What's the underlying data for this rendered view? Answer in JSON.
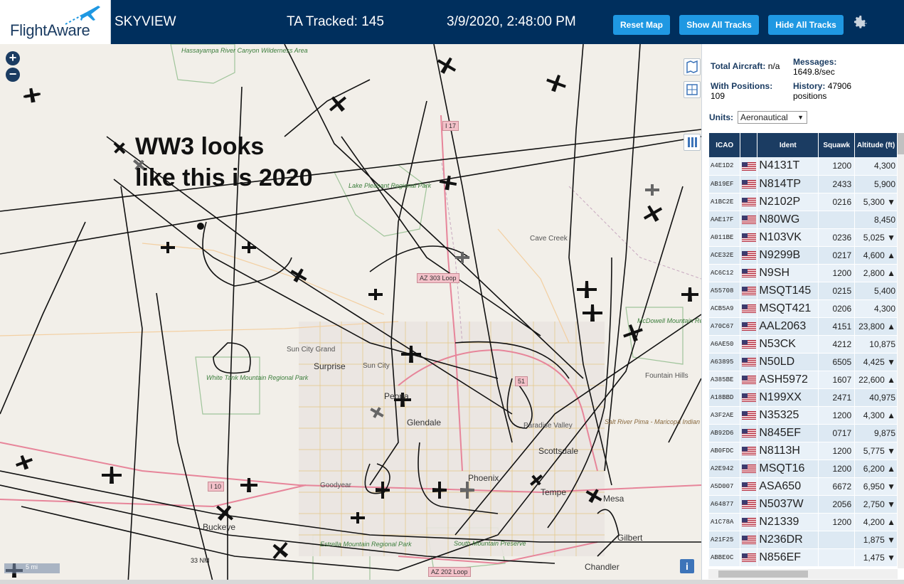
{
  "header": {
    "logo_text": "FlightAware",
    "app_title": "SKYVIEW",
    "ta_tracked": "TA Tracked: 145",
    "datetime": "3/9/2020, 2:48:00 PM",
    "buttons": {
      "reset": "Reset Map",
      "show_all": "Show All Tracks",
      "hide_all": "Hide All Tracks"
    },
    "settings_icon": "gear-icon"
  },
  "map": {
    "annotation": "WW3 looks\nlike this is 2020",
    "zoom_in": "+",
    "zoom_out": "−",
    "scale_label": "5 mi",
    "scale_nm": "33 NM",
    "info": "i",
    "labels": {
      "hassayampa": "Hassayampa River Canyon Wilderness Area",
      "lake_pleasant": "Lake Pleasant Regional Park",
      "cave_creek": "Cave Creek",
      "sun_city_grand": "Sun City Grand",
      "surprise": "Surprise",
      "sun_city": "Sun City",
      "white_tank": "White Tank Mountain Regional Park",
      "peoria": "Peoria",
      "glendale": "Glendale",
      "paradise_valley": "Paradise Valley",
      "scottsdale": "Scottsdale",
      "phoenix": "Phoenix",
      "tempe": "Tempe",
      "mesa": "Mesa",
      "goodyear": "Goodyear",
      "buckeye": "Buckeye",
      "gilbert": "Gilbert",
      "chandler": "Chandler",
      "fountain_hills": "Fountain Hills",
      "mcdowell": "McDowell Mountain Regional Park",
      "salt_river": "Salt River Pima - Maricopa Indian Community",
      "south_mountain": "South Mountain Preserve",
      "estrella": "Estrella Mountain Regional Park"
    },
    "roads": {
      "i17": "I 17",
      "i10": "I 10",
      "az303": "AZ 303 Loop",
      "az202": "AZ 202 Loop",
      "r51": "51",
      "r17b": "I 17"
    }
  },
  "sidebar": {
    "stats": {
      "total_label": "Total Aircraft:",
      "total_value": "n/a",
      "messages_label": "Messages:",
      "messages_value": "1649.8/sec",
      "positions_label": "With Positions:",
      "positions_value": "109",
      "history_label": "History:",
      "history_value": "47906 positions"
    },
    "units_label": "Units:",
    "units_value": "Aeronautical",
    "table": {
      "columns": [
        "ICAO",
        "",
        "Ident",
        "Squawk",
        "Altitude (ft)"
      ],
      "rows": [
        {
          "icao": "A4E1D2",
          "ident": "N4131T",
          "squawk": "1200",
          "alt": "4,300"
        },
        {
          "icao": "AB19EF",
          "ident": "N814TP",
          "squawk": "2433",
          "alt": "5,900"
        },
        {
          "icao": "A1BC2E",
          "ident": "N2102P",
          "squawk": "0216",
          "alt": "5,300 ▼"
        },
        {
          "icao": "AAE17F",
          "ident": "N80WG",
          "squawk": "",
          "alt": "8,450"
        },
        {
          "icao": "A011BE",
          "ident": "N103VK",
          "squawk": "0236",
          "alt": "5,025 ▼"
        },
        {
          "icao": "ACE32E",
          "ident": "N9299B",
          "squawk": "0217",
          "alt": "4,600 ▲"
        },
        {
          "icao": "AC6C12",
          "ident": "N9SH",
          "squawk": "1200",
          "alt": "2,800 ▲"
        },
        {
          "icao": "A55708",
          "ident": "MSQT145",
          "squawk": "0215",
          "alt": "5,400"
        },
        {
          "icao": "ACB5A9",
          "ident": "MSQT421",
          "squawk": "0206",
          "alt": "4,300"
        },
        {
          "icao": "A70C67",
          "ident": "AAL2063",
          "squawk": "4151",
          "alt": "23,800 ▲"
        },
        {
          "icao": "A6AE50",
          "ident": "N53CK",
          "squawk": "4212",
          "alt": "10,875"
        },
        {
          "icao": "A63895",
          "ident": "N50LD",
          "squawk": "6505",
          "alt": "4,425 ▼"
        },
        {
          "icao": "A385BE",
          "ident": "ASH5972",
          "squawk": "1607",
          "alt": "22,600 ▲"
        },
        {
          "icao": "A18BBD",
          "ident": "N199XX",
          "squawk": "2471",
          "alt": "40,975"
        },
        {
          "icao": "A3F2AE",
          "ident": "N35325",
          "squawk": "1200",
          "alt": "4,300 ▲"
        },
        {
          "icao": "AB92D6",
          "ident": "N845EF",
          "squawk": "0717",
          "alt": "9,875"
        },
        {
          "icao": "AB0FDC",
          "ident": "N8113H",
          "squawk": "1200",
          "alt": "5,775 ▼"
        },
        {
          "icao": "A2E942",
          "ident": "MSQT16",
          "squawk": "1200",
          "alt": "6,200 ▲"
        },
        {
          "icao": "A5D007",
          "ident": "ASA650",
          "squawk": "6672",
          "alt": "6,950 ▼"
        },
        {
          "icao": "A64877",
          "ident": "N5037W",
          "squawk": "2056",
          "alt": "2,750 ▼"
        },
        {
          "icao": "A1C78A",
          "ident": "N21339",
          "squawk": "1200",
          "alt": "4,200 ▲"
        },
        {
          "icao": "A21F25",
          "ident": "N236DR",
          "squawk": "",
          "alt": "1,875 ▼"
        },
        {
          "icao": "ABBE0C",
          "ident": "N856EF",
          "squawk": "",
          "alt": "1,475 ▼"
        }
      ]
    }
  },
  "colors": {
    "header_bg": "#002f5d",
    "button_bg": "#1f98e2",
    "table_header": "#1b3c62",
    "row_a": "#e9f1f8",
    "row_b": "#dde9f3"
  }
}
